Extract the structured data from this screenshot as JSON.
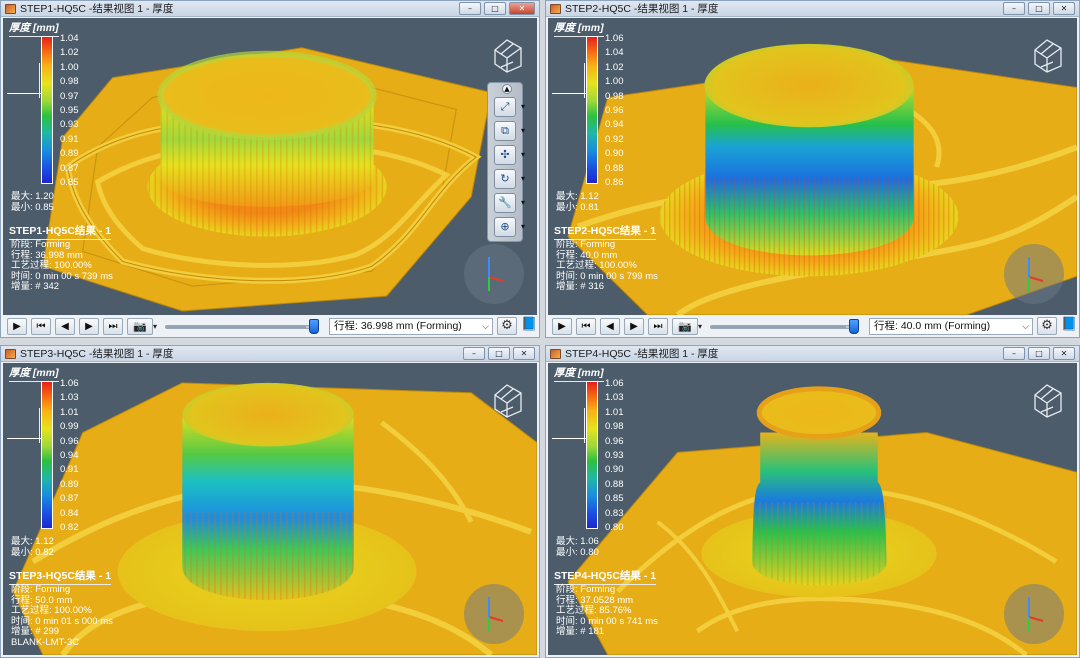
{
  "windows": [
    {
      "title": "STEP1-HQ5C -结果视图 1 - 厚度",
      "legend_title": "厚度 [mm]",
      "legend_ticks": [
        "1.04",
        "1.02",
        "1.00",
        "0.98",
        "0.97",
        "0.95",
        "0.93",
        "0.91",
        "0.89",
        "0.87",
        "0.85"
      ],
      "max_label": "最大:  1.20",
      "min_label": "最小:  0.85",
      "result_title": "STEP1-HQ5C结果 - 1",
      "info": [
        "阶段: Forming",
        "行程: 36.998 mm",
        "工艺过程: 100.00%",
        "时间: 0 min 00 s 739 ms",
        "增量: # 342"
      ],
      "stroke_combo": "行程: 36.998 mm (Forming)",
      "slider_position": 0.96
    },
    {
      "title": "STEP2-HQ5C -结果视图 1 - 厚度",
      "legend_title": "厚度 [mm]",
      "legend_ticks": [
        "1.06",
        "1.04",
        "1.02",
        "1.00",
        "0.98",
        "0.96",
        "0.94",
        "0.92",
        "0.90",
        "0.88",
        "0.86"
      ],
      "max_label": "最大:  1.12",
      "min_label": "最小:  0.81",
      "result_title": "STEP2-HQ5C结果 - 1",
      "info": [
        "阶段: Forming",
        "行程: 40.0 mm",
        "工艺过程: 100.00%",
        "时间: 0 min 00 s 799 ms",
        "增量: # 316"
      ],
      "stroke_combo": "行程: 40.0 mm (Forming)",
      "slider_position": 0.96
    },
    {
      "title": "STEP3-HQ5C -结果视图 1 - 厚度",
      "legend_title": "厚度 [mm]",
      "legend_ticks": [
        "1.06",
        "1.03",
        "1.01",
        "0.99",
        "0.96",
        "0.94",
        "0.91",
        "0.89",
        "0.87",
        "0.84",
        "0.82"
      ],
      "max_label": "最大:  1.12",
      "min_label": "最小:  0.82",
      "result_title": "STEP3-HQ5C结果 - 1",
      "info": [
        "阶段: Forming",
        "行程: 50.0 mm",
        "工艺过程: 100.00%",
        "时间: 0 min 01 s 000 ms",
        "增量: # 299",
        "BLANK-LMT-3C"
      ]
    },
    {
      "title": "STEP4-HQ5C -结果视图 1 - 厚度",
      "legend_title": "厚度 [mm]",
      "legend_ticks": [
        "1.06",
        "1.03",
        "1.01",
        "0.98",
        "0.96",
        "0.93",
        "0.90",
        "0.88",
        "0.85",
        "0.83",
        "0.80"
      ],
      "max_label": "最大:  1.06",
      "min_label": "最小:  0.80",
      "result_title": "STEP4-HQ5C结果 - 1",
      "info": [
        "阶段: Forming",
        "行程: 37.0528 mm",
        "工艺过程: 85.76%",
        "时间: 0 min 00 s 741 ms",
        "增量: # 181"
      ]
    }
  ],
  "window_buttons": {
    "minimize": "–",
    "maximize": "□",
    "close": "✕"
  },
  "playback": {
    "play": "▶",
    "first": "⏮",
    "prev": "◀",
    "next": "▶",
    "last": "⏭",
    "camera": "📷"
  },
  "colors": {
    "viewport_bg": "#4c5c6b",
    "plate": "#e8b21a",
    "hot": "#e8201a",
    "cold": "#1c27cf"
  },
  "icons": [
    "app-icon",
    "logo-icon",
    "triad-icon",
    "zoom-icon",
    "rotate-icon",
    "fit-icon",
    "view-icon",
    "tool-icon",
    "reset-icon",
    "gear-icon",
    "book-icon",
    "camera-icon"
  ]
}
